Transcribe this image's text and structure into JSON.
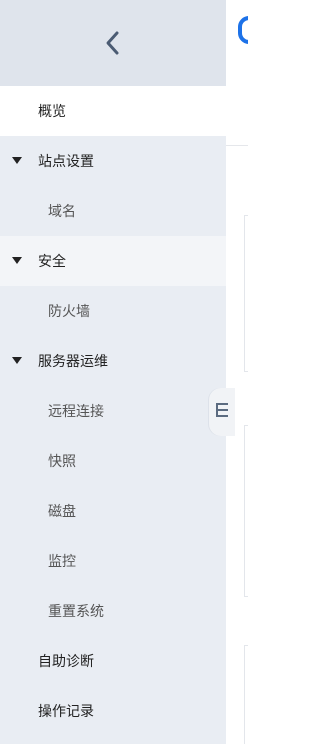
{
  "sidebar": {
    "collapse_icon": "chevron-left-icon",
    "items": [
      {
        "type": "top",
        "label": "概览",
        "selected": true
      },
      {
        "type": "group",
        "label": "站点设置"
      },
      {
        "type": "sub",
        "label": "域名"
      },
      {
        "type": "group",
        "label": "安全",
        "highlight": true
      },
      {
        "type": "sub",
        "label": "防火墙"
      },
      {
        "type": "group",
        "label": "服务器运维"
      },
      {
        "type": "sub",
        "label": "远程连接"
      },
      {
        "type": "sub",
        "label": "快照"
      },
      {
        "type": "sub",
        "label": "磁盘"
      },
      {
        "type": "sub",
        "label": "监控"
      },
      {
        "type": "sub",
        "label": "重置系统"
      },
      {
        "type": "top",
        "label": "自助诊断"
      },
      {
        "type": "top",
        "label": "操作记录"
      }
    ]
  },
  "handle": {
    "icon": "panel-toggle-icon"
  },
  "colors": {
    "sidebar_bg": "#e9edf3",
    "selected_bg": "#ffffff",
    "accent": "#1d72e8",
    "text": "#222222"
  }
}
